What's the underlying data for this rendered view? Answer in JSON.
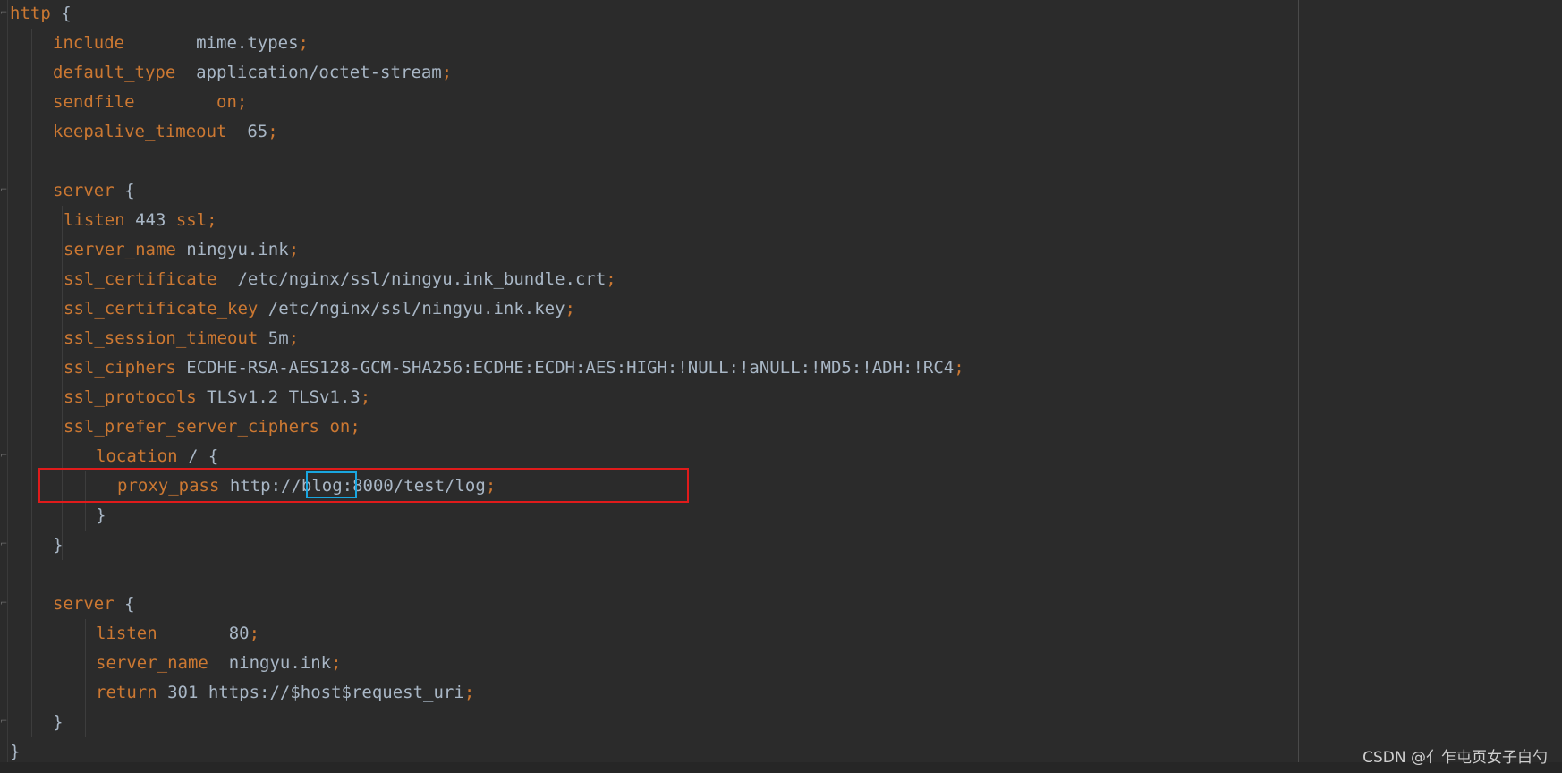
{
  "editor": {
    "lines": [
      {
        "id": "l1",
        "indent": 0,
        "parts": [
          {
            "t": "http",
            "c": "kw"
          },
          {
            "t": " {",
            "c": "br"
          }
        ]
      },
      {
        "id": "l2",
        "indent": 1,
        "parts": [
          {
            "t": "include",
            "c": "kw"
          },
          {
            "t": "       mime.types",
            "c": "tx"
          },
          {
            "t": ";",
            "c": "pn"
          }
        ]
      },
      {
        "id": "l3",
        "indent": 1,
        "parts": [
          {
            "t": "default_type",
            "c": "kw"
          },
          {
            "t": "  application/octet-stream",
            "c": "tx"
          },
          {
            "t": ";",
            "c": "pn"
          }
        ]
      },
      {
        "id": "l4",
        "indent": 1,
        "parts": [
          {
            "t": "sendfile",
            "c": "kw"
          },
          {
            "t": "        ",
            "c": "tx"
          },
          {
            "t": "on",
            "c": "kw"
          },
          {
            "t": ";",
            "c": "pn"
          }
        ]
      },
      {
        "id": "l5",
        "indent": 1,
        "parts": [
          {
            "t": "keepalive_timeout",
            "c": "kw"
          },
          {
            "t": "  65",
            "c": "tx"
          },
          {
            "t": ";",
            "c": "pn"
          }
        ]
      },
      {
        "id": "l6",
        "indent": 0,
        "parts": []
      },
      {
        "id": "l7",
        "indent": 1,
        "parts": [
          {
            "t": "server",
            "c": "kw"
          },
          {
            "t": " {",
            "c": "br"
          }
        ]
      },
      {
        "id": "l8",
        "indent": 1.25,
        "parts": [
          {
            "t": "listen",
            "c": "kw"
          },
          {
            "t": " 443 ",
            "c": "tx"
          },
          {
            "t": "ssl",
            "c": "kw"
          },
          {
            "t": ";",
            "c": "pn"
          }
        ]
      },
      {
        "id": "l9",
        "indent": 1.25,
        "parts": [
          {
            "t": "server_name",
            "c": "kw"
          },
          {
            "t": " ningyu.ink",
            "c": "tx"
          },
          {
            "t": ";",
            "c": "pn"
          }
        ]
      },
      {
        "id": "l10",
        "indent": 1.25,
        "parts": [
          {
            "t": "ssl_certificate",
            "c": "kw"
          },
          {
            "t": "  /etc/nginx/ssl/ningyu.ink_bundle.crt",
            "c": "tx"
          },
          {
            "t": ";",
            "c": "pn"
          }
        ]
      },
      {
        "id": "l11",
        "indent": 1.25,
        "parts": [
          {
            "t": "ssl_certificate_key",
            "c": "kw"
          },
          {
            "t": " /etc/nginx/ssl/ningyu.ink.key",
            "c": "tx"
          },
          {
            "t": ";",
            "c": "pn"
          }
        ]
      },
      {
        "id": "l12",
        "indent": 1.25,
        "parts": [
          {
            "t": "ssl_session_timeout",
            "c": "kw"
          },
          {
            "t": " 5m",
            "c": "tx"
          },
          {
            "t": ";",
            "c": "pn"
          }
        ]
      },
      {
        "id": "l13",
        "indent": 1.25,
        "parts": [
          {
            "t": "ssl_ciphers",
            "c": "kw"
          },
          {
            "t": " ECDHE-RSA-AES128-GCM-SHA256:ECDHE:ECDH:AES:HIGH:!NULL:!aNULL:!MD5:!ADH:!RC4",
            "c": "tx"
          },
          {
            "t": ";",
            "c": "pn"
          }
        ]
      },
      {
        "id": "l14",
        "indent": 1.25,
        "parts": [
          {
            "t": "ssl_protocols",
            "c": "kw"
          },
          {
            "t": " TLSv1.2 TLSv1.3",
            "c": "tx"
          },
          {
            "t": ";",
            "c": "pn"
          }
        ]
      },
      {
        "id": "l15",
        "indent": 1.25,
        "parts": [
          {
            "t": "ssl_prefer_server_ciphers",
            "c": "kw"
          },
          {
            "t": " ",
            "c": "tx"
          },
          {
            "t": "on",
            "c": "kw"
          },
          {
            "t": ";",
            "c": "pn"
          }
        ]
      },
      {
        "id": "l16",
        "indent": 2,
        "parts": [
          {
            "t": "location",
            "c": "kw"
          },
          {
            "t": " / {",
            "c": "br"
          }
        ]
      },
      {
        "id": "l17",
        "indent": 2.5,
        "parts": [
          {
            "t": "proxy_pass",
            "c": "kw"
          },
          {
            "t": " http://blog:8000/test/log",
            "c": "tx"
          },
          {
            "t": ";",
            "c": "pn"
          }
        ]
      },
      {
        "id": "l18",
        "indent": 2,
        "parts": [
          {
            "t": "}",
            "c": "br"
          }
        ]
      },
      {
        "id": "l19",
        "indent": 1,
        "parts": [
          {
            "t": "}",
            "c": "br"
          }
        ]
      },
      {
        "id": "l20",
        "indent": 0,
        "parts": []
      },
      {
        "id": "l21",
        "indent": 1,
        "parts": [
          {
            "t": "server",
            "c": "kw"
          },
          {
            "t": " {",
            "c": "br"
          }
        ]
      },
      {
        "id": "l22",
        "indent": 2,
        "parts": [
          {
            "t": "listen",
            "c": "kw"
          },
          {
            "t": "       80",
            "c": "tx"
          },
          {
            "t": ";",
            "c": "pn"
          }
        ]
      },
      {
        "id": "l23",
        "indent": 2,
        "parts": [
          {
            "t": "server_name",
            "c": "kw"
          },
          {
            "t": "  ningyu.ink",
            "c": "tx"
          },
          {
            "t": ";",
            "c": "pn"
          }
        ]
      },
      {
        "id": "l24",
        "indent": 2,
        "parts": [
          {
            "t": "return",
            "c": "kw"
          },
          {
            "t": " 301 https://$host$request_uri",
            "c": "tx"
          },
          {
            "t": ";",
            "c": "pn"
          }
        ]
      },
      {
        "id": "l25",
        "indent": 1,
        "parts": [
          {
            "t": "}",
            "c": "br"
          }
        ]
      },
      {
        "id": "l26",
        "indent": 0,
        "parts": [
          {
            "t": "}",
            "c": "br"
          }
        ]
      }
    ]
  },
  "watermark": "CSDN @亻乍屯页女子白勺",
  "colors": {
    "background": "#2b2b2b",
    "keyword": "#cc7832",
    "text": "#a9b7c6",
    "highlight_red": "#e01b1b",
    "highlight_blue": "#19a6e0"
  }
}
